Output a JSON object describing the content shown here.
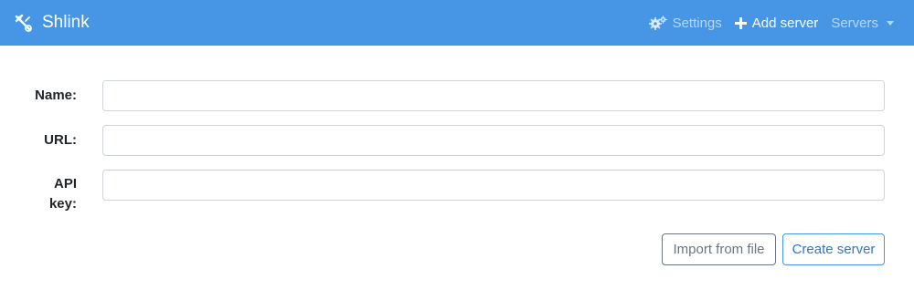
{
  "navbar": {
    "brand": "Shlink",
    "settings_label": "Settings",
    "add_server_label": "Add server",
    "servers_label": "Servers",
    "icons": {
      "brand": "shlink-logo-icon",
      "settings": "gears-icon",
      "add": "plus-icon",
      "dropdown": "caret-down-icon"
    },
    "background_color": "#4696e5"
  },
  "form": {
    "name_label": "Name:",
    "url_label": "URL:",
    "api_key_label_line1": "API",
    "api_key_label_line2": "key:",
    "name_value": "",
    "url_value": "",
    "api_key_value": "",
    "import_button": "Import from file",
    "create_button": "Create server"
  }
}
